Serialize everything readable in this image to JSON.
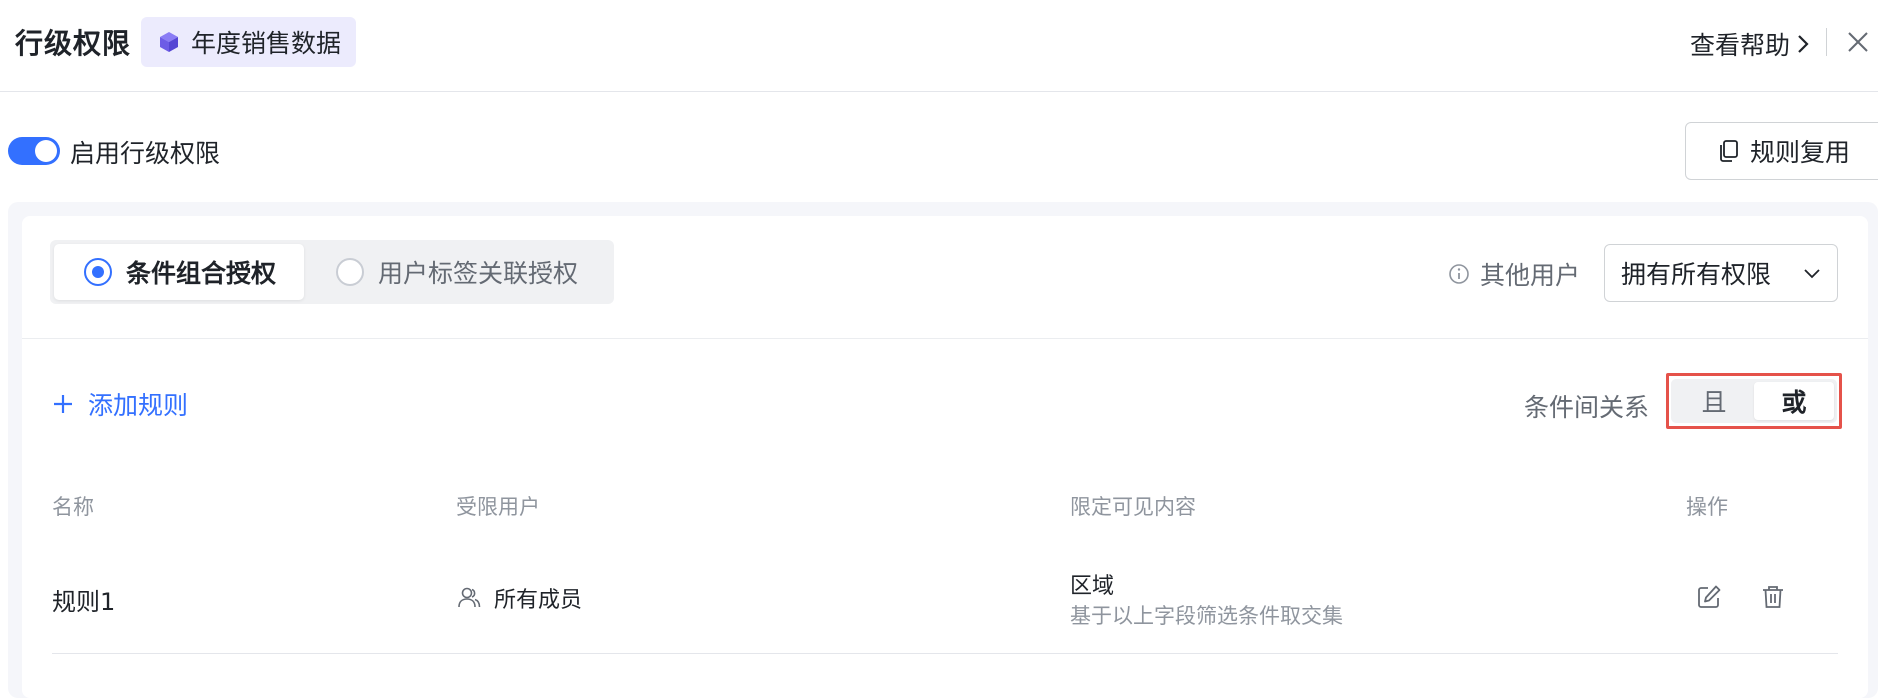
{
  "header": {
    "title": "行级权限",
    "dataset_name": "年度销售数据",
    "help_label": "查看帮助"
  },
  "toggle": {
    "enabled": true,
    "label": "启用行级权限"
  },
  "reuse_button": {
    "label": "规则复用"
  },
  "auth_mode": {
    "options": [
      {
        "label": "条件组合授权",
        "selected": true
      },
      {
        "label": "用户标签关联授权",
        "selected": false
      }
    ]
  },
  "other_users": {
    "label": "其他用户",
    "selected_value": "拥有所有权限"
  },
  "add_rule_label": "添加规则",
  "relation": {
    "label": "条件间关系",
    "options": [
      {
        "label": "且",
        "selected": false
      },
      {
        "label": "或",
        "selected": true
      }
    ]
  },
  "table": {
    "columns": [
      "名称",
      "受限用户",
      "限定可见内容",
      "操作"
    ],
    "rows": [
      {
        "name": "规则1",
        "users": "所有成员",
        "content_title": "区域",
        "content_desc": "基于以上字段筛选条件取交集"
      }
    ]
  },
  "colors": {
    "accent": "#3370ff",
    "highlight_border": "#e5524a",
    "dataset_tag_bg": "#ecebfd"
  }
}
